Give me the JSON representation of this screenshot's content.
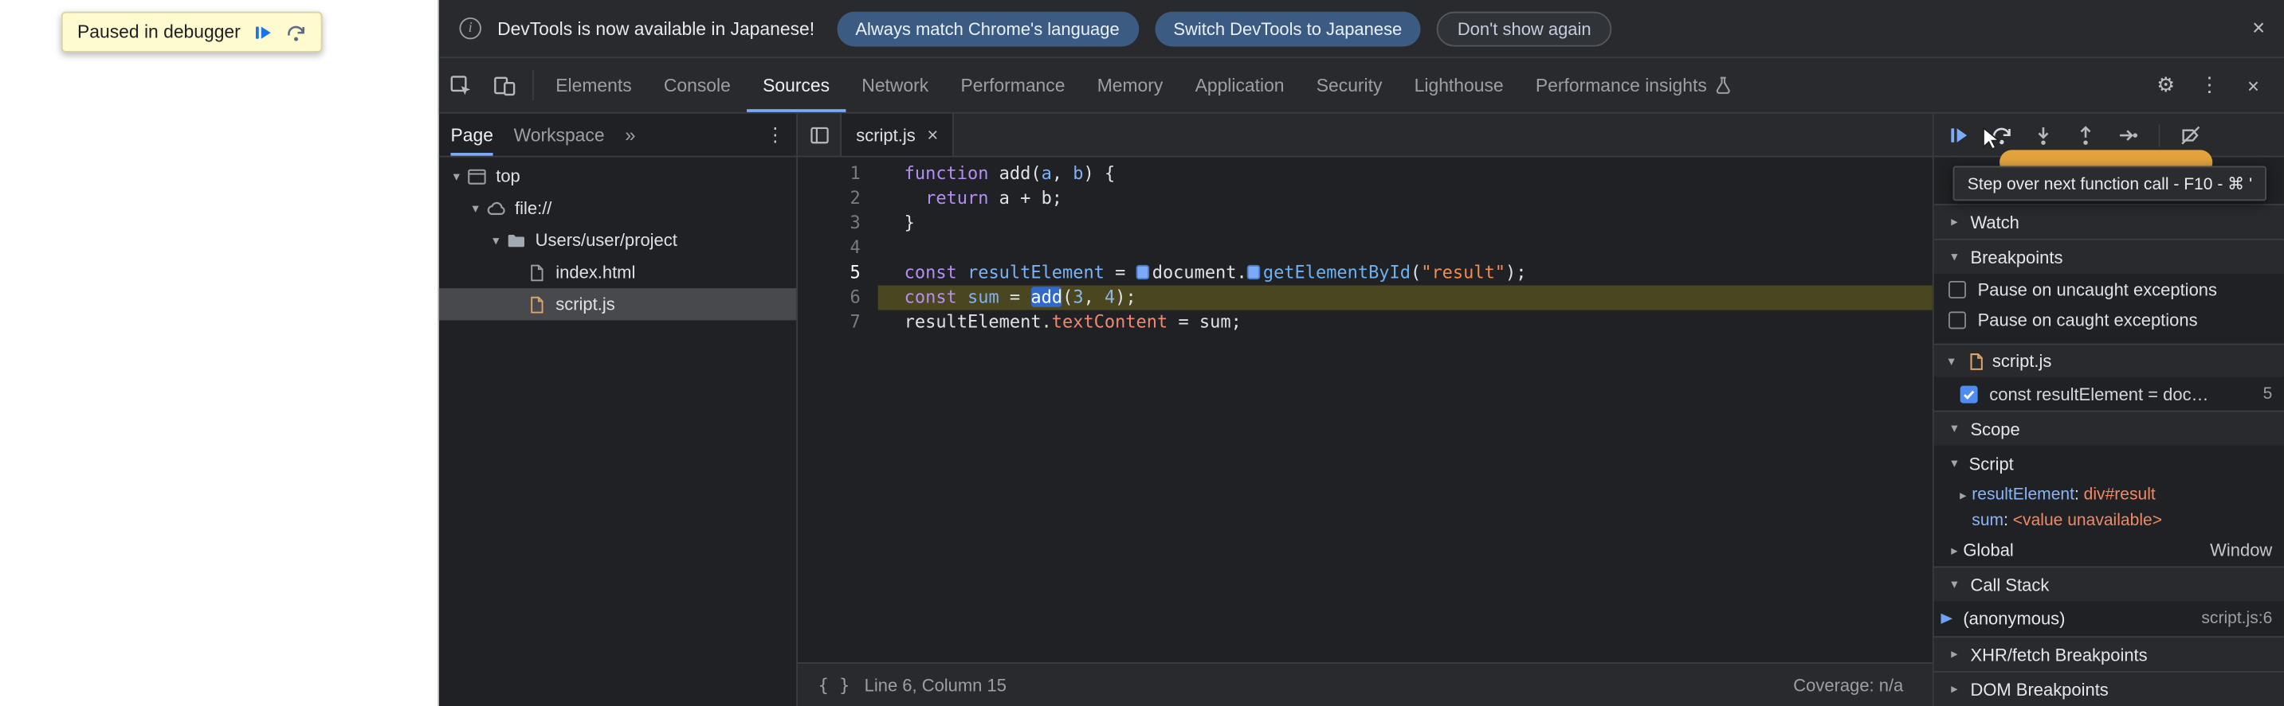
{
  "colors": {
    "accent_blue": "#7cacf8",
    "breakpoint_blue": "#4285f4",
    "exec_line_gold": "#4a461f",
    "string_orange": "#f28b54",
    "paused_pill_orange": "#e2a23c"
  },
  "glyphs": {
    "close": "×",
    "kebab": "⋮",
    "gear": "⚙",
    "more_tabs": "»",
    "arrow_down": "▾",
    "arrow_right": "▸",
    "braces": "{ }",
    "info": "i",
    "colon": ": "
  },
  "page_overlay": {
    "paused_text": "Paused in debugger"
  },
  "infobar": {
    "message": "DevTools is now available in Japanese!",
    "btn_match": "Always match Chrome's language",
    "btn_switch": "Switch DevTools to Japanese",
    "btn_dismiss": "Don't show again"
  },
  "toolbar": {
    "tabs": [
      "Elements",
      "Console",
      "Sources",
      "Network",
      "Performance",
      "Memory",
      "Application",
      "Security",
      "Lighthouse",
      "Performance insights"
    ],
    "selected": "Sources"
  },
  "navigator": {
    "tab_page": "Page",
    "tab_workspace": "Workspace",
    "tree": [
      {
        "label": "top"
      },
      {
        "label": "file://"
      },
      {
        "label": "Users/user/project"
      },
      {
        "label": "index.html"
      },
      {
        "label": "script.js"
      }
    ]
  },
  "editor": {
    "tab_label": "script.js",
    "gutter": [
      "1",
      "2",
      "3",
      "4",
      "5",
      "6",
      "7"
    ],
    "code": {
      "l1": [
        "function",
        " ",
        "add",
        "(",
        "a",
        ", ",
        "b",
        ") {"
      ],
      "l2": [
        "  ",
        "return",
        " a + b;"
      ],
      "l3": [
        "}"
      ],
      "l4": [
        ""
      ],
      "l5": [
        "const",
        " ",
        "resultElement",
        " = ",
        "document.",
        "getElementById",
        "(",
        "\"result\"",
        ");"
      ],
      "l6": [
        "const",
        " ",
        "sum",
        " = ",
        "add",
        "(",
        "3",
        ", ",
        "4",
        ");"
      ],
      "l7": [
        "resultElement.",
        "textContent",
        " = sum;"
      ]
    },
    "status_line": "Line 6, Column 15",
    "coverage": "Coverage: n/a"
  },
  "sidebar": {
    "tooltip": "Step over next function call - F10 - ⌘ '",
    "watch": "Watch",
    "breakpoints": "Breakpoints",
    "pause_uncaught": "Pause on uncaught exceptions",
    "pause_caught": "Pause on caught exceptions",
    "bp_file": "script.js",
    "bp_snippet": "const resultElement = doc…",
    "bp_line": "5",
    "scope": "Scope",
    "scope_script": "Script",
    "var1_name": "resultElement",
    "var1_value": "div#result",
    "var2_name": "sum",
    "var2_value": "<value unavailable>",
    "global": "Global",
    "global_value": "Window",
    "call_stack": "Call Stack",
    "frame_name": "(anonymous)",
    "frame_loc": "script.js:6",
    "xhr": "XHR/fetch Breakpoints",
    "dom": "DOM Breakpoints"
  }
}
